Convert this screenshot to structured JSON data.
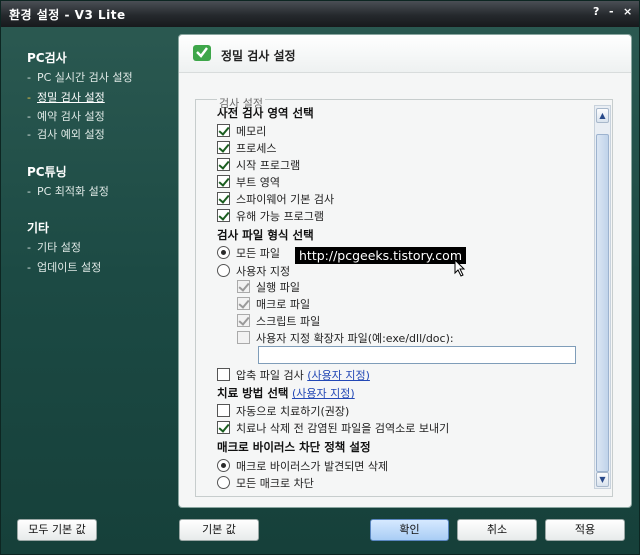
{
  "window": {
    "title": "환경 설정 - V3 Lite",
    "help": "?",
    "minimize": "-",
    "close": "×"
  },
  "sidebar": {
    "categories": [
      {
        "label": "PC검사",
        "items": [
          "PC 실시간 검사 설정",
          "정밀 검사 설정",
          "예약 검사 설정",
          "검사 예외 설정"
        ]
      },
      {
        "label": "PC튜닝",
        "items": [
          "PC 최적화 설정"
        ]
      },
      {
        "label": "기타",
        "items": [
          "기타 설정",
          "업데이트 설정"
        ]
      }
    ],
    "active_item": "정밀 검사 설정"
  },
  "panel": {
    "title": "정밀 검사 설정",
    "group_legend": "검사 설정",
    "sections": {
      "scan_area": {
        "title": "사전 검사 영역 선택",
        "options": [
          "메모리",
          "프로세스",
          "시작 프로그램",
          "부트 영역",
          "스파이웨어 기본 검사",
          "유해 가능 프로그램"
        ],
        "checked": [
          true,
          true,
          true,
          true,
          true,
          true
        ]
      },
      "file_format": {
        "title": "검사 파일 형식 선택",
        "all_files": "모든 파일",
        "user_defined": "사용자 지정",
        "selected": "all_files",
        "sub_options": [
          "실행 파일",
          "매크로 파일",
          "스크립트 파일",
          "사용자 지정 확장자 파일(예:exe/dll/doc):"
        ],
        "sub_checked": [
          true,
          true,
          true,
          false
        ],
        "extension_value": ""
      },
      "compressed": {
        "label": "압축 파일 검사",
        "link": "(사용자 지정)",
        "checked": false
      },
      "cure": {
        "title": "치료 방법 선택",
        "link": "(사용자 지정)",
        "options": [
          "자동으로 치료하기(권장)",
          "치료나 삭제 전 감염된 파일을 검역소로 보내기"
        ],
        "checked": [
          false,
          true
        ]
      },
      "macro": {
        "title": "매크로 바이러스 차단 정책 설정",
        "options": [
          "매크로 바이러스가 발견되면 삭제",
          "모든 매크로 차단"
        ],
        "selected": 0
      }
    }
  },
  "watermark": "http://pcgeeks.tistory.com",
  "buttons": {
    "reset_all": "모두 기본 값",
    "reset": "기본 값",
    "ok": "확인",
    "cancel": "취소",
    "apply": "적용"
  }
}
